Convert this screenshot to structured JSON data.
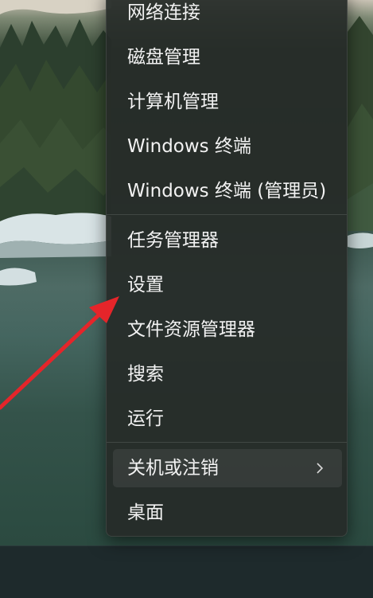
{
  "menu": {
    "items": [
      {
        "label": "网络连接"
      },
      {
        "label": "磁盘管理"
      },
      {
        "label": "计算机管理"
      },
      {
        "label": "Windows 终端"
      },
      {
        "label": "Windows 终端 (管理员)"
      },
      {
        "label": "任务管理器"
      },
      {
        "label": "设置"
      },
      {
        "label": "文件资源管理器"
      },
      {
        "label": "搜索"
      },
      {
        "label": "运行"
      },
      {
        "label": "关机或注销",
        "submenu_icon": "chevron-right-icon"
      },
      {
        "label": "桌面"
      }
    ]
  },
  "annotation": {
    "arrow_color": "#e5252a",
    "arrow_icon": "red-arrow-pointer"
  }
}
